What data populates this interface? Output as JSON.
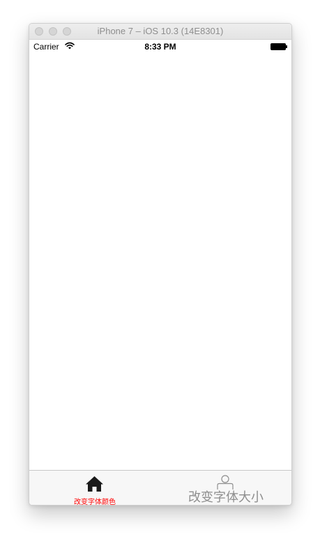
{
  "window": {
    "title": "iPhone 7 – iOS 10.3 (14E8301)"
  },
  "status_bar": {
    "carrier": "Carrier",
    "time": "8:33 PM",
    "icons": [
      "wifi-icon",
      "battery-icon"
    ]
  },
  "tab_bar": {
    "tabs": [
      {
        "label": "改变字体颜色",
        "icon": "home-icon",
        "label_color": "#ff0000",
        "selected": true
      },
      {
        "label": "改变字体大小",
        "icon": "user-icon",
        "label_color": "#8e8e8e",
        "selected": false
      }
    ]
  },
  "colors": {
    "tab_bar_background": "#f7f7f7",
    "selected_icon": "#1a1a1a",
    "unselected_icon": "#8e8e8e"
  }
}
